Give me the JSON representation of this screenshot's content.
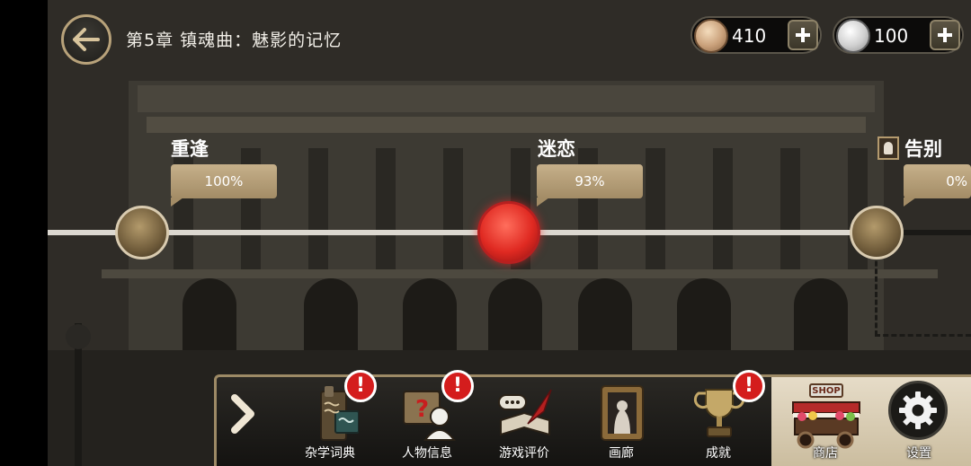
{
  "header": {
    "back_icon": "arrow-left-icon",
    "chapter_title": "第5章  镇魂曲：魅影的记忆"
  },
  "currencies": [
    {
      "icon": "bronze-coin-icon",
      "amount": "410",
      "plus_icon": "plus-icon"
    },
    {
      "icon": "silver-coin-icon",
      "amount": "100",
      "plus_icon": "plus-icon"
    }
  ],
  "timeline": {
    "nodes": [
      {
        "label": "重逢",
        "progress": "100%",
        "progress_value": 100,
        "state": "completed"
      },
      {
        "label": "迷恋",
        "progress": "93%",
        "progress_value": 93,
        "state": "current"
      },
      {
        "label": "告别",
        "progress": "0%",
        "progress_value": 0,
        "state": "locked",
        "icon": "portrait-icon"
      }
    ]
  },
  "menu": {
    "expand_icon": "chevron-right-icon",
    "items": [
      {
        "label": "杂学词典",
        "icon": "dictionary-book-icon",
        "badge": "!"
      },
      {
        "label": "人物信息",
        "icon": "character-info-icon",
        "badge": "!"
      },
      {
        "label": "游戏评价",
        "icon": "quill-review-icon",
        "badge": ""
      },
      {
        "label": "画廊",
        "icon": "gallery-frame-icon",
        "badge": ""
      },
      {
        "label": "成就",
        "icon": "trophy-icon",
        "badge": "!"
      }
    ],
    "shop": {
      "label": "商店",
      "sign": "SHOP",
      "icon": "shop-cart-icon"
    },
    "settings": {
      "label": "设置",
      "icon": "gear-icon"
    }
  },
  "colors": {
    "accent_gold": "#b8a27a",
    "current_node_red": "#e02a22",
    "badge_red": "#d41d1d",
    "tag_tan": "#b49d76"
  }
}
